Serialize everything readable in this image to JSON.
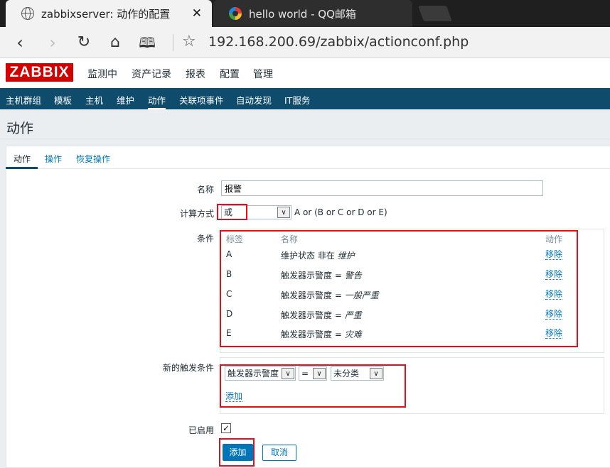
{
  "browser": {
    "tabs": [
      {
        "title": "zabbixserver: 动作的配置",
        "icon": "globe-icon",
        "close": "✕"
      },
      {
        "title": "hello world - QQ邮箱",
        "icon": "qq-mail-icon"
      }
    ],
    "url": "192.168.200.69/zabbix/actionconf.php",
    "nav_icons": [
      "back-icon",
      "forward-icon",
      "reload-icon",
      "home-icon",
      "reading-icon",
      "bookmark-star-icon"
    ]
  },
  "logo": "ZABBIX",
  "top_nav": [
    "监测中",
    "资产记录",
    "报表",
    "配置",
    "管理"
  ],
  "sub_nav": [
    "主机群组",
    "模板",
    "主机",
    "维护",
    "动作",
    "关联项事件",
    "自动发现",
    "IT服务"
  ],
  "sub_nav_active": "动作",
  "page_title": "动作",
  "form_tabs": [
    "动作",
    "操作",
    "恢复操作"
  ],
  "form": {
    "name_label": "名称",
    "name_value": "报警",
    "calc_label": "计算方式",
    "calc_value": "或",
    "calc_expression": "A or (B or C or D or E)",
    "conditions_label": "条件",
    "conditions_headers": {
      "tag": "标签",
      "name": "名称",
      "action": "动作"
    },
    "conditions": [
      {
        "tag": "A",
        "name_prefix": "维护状态 非在 ",
        "name_value": "维护",
        "action": "移除"
      },
      {
        "tag": "B",
        "name_prefix": "触发器示警度 = ",
        "name_value": "警告",
        "action": "移除"
      },
      {
        "tag": "C",
        "name_prefix": "触发器示警度 = ",
        "name_value": "一般严重",
        "action": "移除"
      },
      {
        "tag": "D",
        "name_prefix": "触发器示警度 = ",
        "name_value": "严重",
        "action": "移除"
      },
      {
        "tag": "E",
        "name_prefix": "触发器示警度 = ",
        "name_value": "灾难",
        "action": "移除"
      }
    ],
    "new_condition_label": "新的触发条件",
    "new_condition": {
      "type": "触发器示警度",
      "operator": "=",
      "value": "未分类",
      "add_link": "添加"
    },
    "enabled_label": "已启用",
    "enabled_checked": "✓",
    "submit_label": "添加",
    "cancel_label": "取消"
  },
  "colors": {
    "brand": "#d40000",
    "subnav": "#0f4b6b",
    "link": "#0275b8",
    "annotation": "#e0101a"
  }
}
